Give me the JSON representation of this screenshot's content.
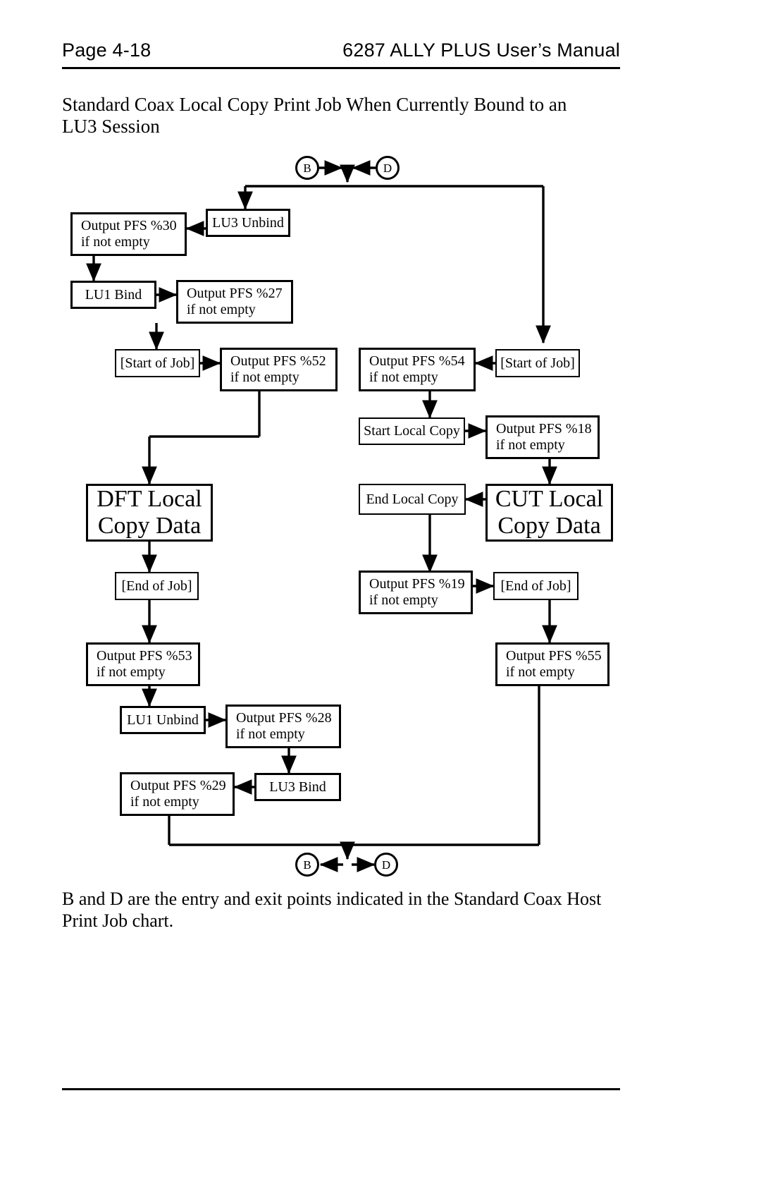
{
  "header": {
    "page_label": "Page 4-18",
    "manual_title": "6287 ALLY PLUS User’s Manual"
  },
  "section": {
    "line1": "Standard  Coax  Local  Copy  Print  Job  When  Currently  Bound  to  an",
    "line2": "LU3  Session"
  },
  "caption": {
    "line1": "B and D are the entry and exit points indicated in the Standard Coax Host",
    "line2": "Print Job chart."
  },
  "diagram": {
    "connectors": {
      "top_b": "B",
      "top_d": "D",
      "bottom_b": "B",
      "bottom_d": "D"
    },
    "nodes": {
      "lu3_unbind": "LU3 Unbind",
      "pfs30_l1": "Output PFS %30",
      "pfs30_l2": "if not empty",
      "lu1_bind": "LU1 Bind",
      "pfs27_l1": "Output PFS %27",
      "pfs27_l2": "if not empty",
      "start_of_job_left": "[Start of Job]",
      "pfs52_l1": "Output PFS %52",
      "pfs52_l2": "if not empty",
      "start_of_job_right": "[Start of Job]",
      "pfs54_l1": "Output PFS %54",
      "pfs54_l2": "if not empty",
      "start_local_copy": "Start Local Copy",
      "pfs18_l1": "Output PFS %18",
      "pfs18_l2": "if not empty",
      "dft_local_copy_l1": "DFT Local",
      "dft_local_copy_l2": "Copy Data",
      "cut_local_copy_l1": "CUT Local",
      "cut_local_copy_l2": "Copy Data",
      "end_local_copy": "End Local Copy",
      "end_of_job_left": "[End of Job]",
      "pfs19_l1": "Output PFS %19",
      "pfs19_l2": "if not empty",
      "end_of_job_right": "[End of Job]",
      "pfs53_l1": "Output PFS %53",
      "pfs53_l2": "if not empty",
      "pfs55_l1": "Output PFS %55",
      "pfs55_l2": "if not empty",
      "lu1_unbind": "LU1 Unbind",
      "pfs28_l1": "Output PFS %28",
      "pfs28_l2": "if not empty",
      "lu3_bind": "LU3 Bind",
      "pfs29_l1": "Output PFS %29",
      "pfs29_l2": "if not empty"
    }
  }
}
